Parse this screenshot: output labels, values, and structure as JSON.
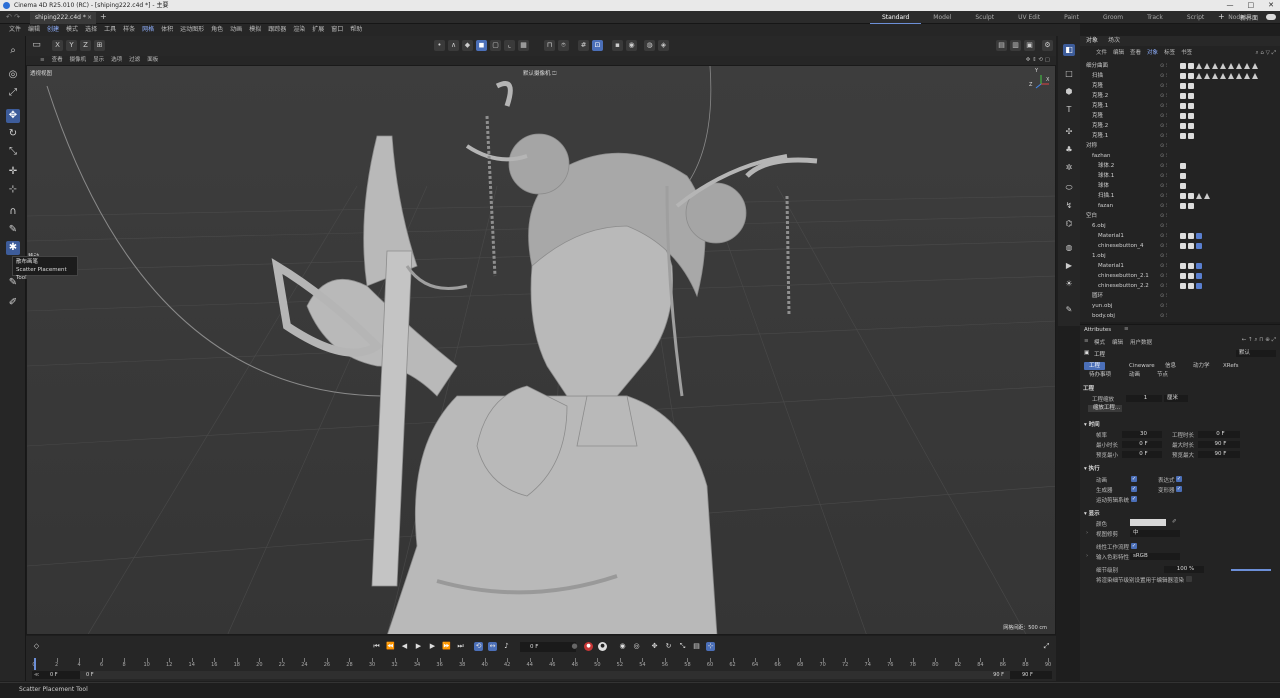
{
  "window": {
    "title": "Cinema 4D R25.010 (RC) - [shiping222.c4d *] - 主要",
    "controls": [
      "—",
      "□",
      "✕"
    ]
  },
  "tabs": {
    "document": "shiping222.c4d *",
    "add": "+"
  },
  "layouts": [
    "Standard",
    "Model",
    "Sculpt",
    "UV Edit",
    "Paint",
    "Groom",
    "Track",
    "Script",
    "Nodes"
  ],
  "layout_active": "Standard",
  "layout_extra": "新界面",
  "menu": [
    "文件",
    "编辑",
    "创建",
    "模式",
    "选择",
    "工具",
    "样条",
    "网格",
    "体积",
    "运动图形",
    "角色",
    "动画",
    "模拟",
    "跟踪器",
    "渲染",
    "扩展",
    "窗口",
    "帮助"
  ],
  "viewport": {
    "menu": [
      "查看",
      "摄像机",
      "显示",
      "选项",
      "过滤",
      "面板"
    ],
    "name": "透视视图",
    "camera": "默认摄像机 ⏍",
    "grid_spacing": "网格间距：500 cm",
    "axis": {
      "x": "X",
      "y": "Y",
      "z": "Z"
    }
  },
  "toolbar_axes": [
    "X",
    "Y",
    "Z"
  ],
  "tooltip": {
    "title": "散布画笔",
    "subtitle": "Scatter Placement Tool",
    "move": "移动"
  },
  "timeline": {
    "current_frame": "0 F",
    "ticks": [
      "0",
      "2",
      "4",
      "6",
      "8",
      "10",
      "12",
      "14",
      "16",
      "18",
      "20",
      "22",
      "24",
      "26",
      "28",
      "30",
      "32",
      "34",
      "36",
      "38",
      "40",
      "42",
      "44",
      "46",
      "48",
      "50",
      "52",
      "54",
      "56",
      "58",
      "60",
      "62",
      "64",
      "66",
      "68",
      "70",
      "72",
      "74",
      "76",
      "78",
      "80",
      "82",
      "84",
      "86",
      "88",
      "90"
    ],
    "range_start": "0 F",
    "range_start2": "0 F",
    "range_end": "90 F",
    "range_end2": "90 F"
  },
  "status": "Scatter Placement Tool",
  "objects": {
    "tabs": [
      "对象",
      "场次"
    ],
    "menu": [
      "文件",
      "编辑",
      "查看",
      "对象",
      "标签",
      "书签"
    ],
    "menu_active": "对象",
    "rows": [
      {
        "name": "细分曲面",
        "indent": 0,
        "tags": "t"
      },
      {
        "name": "扫描",
        "indent": 1,
        "tags": "sweep"
      },
      {
        "name": "克隆",
        "indent": 1,
        "tags": "pair"
      },
      {
        "name": "克隆.2",
        "indent": 1,
        "tags": "pair"
      },
      {
        "name": "克隆.1",
        "indent": 1,
        "tags": "pair"
      },
      {
        "name": "克隆",
        "indent": 1,
        "tags": "pair"
      },
      {
        "name": "克隆.2",
        "indent": 1,
        "tags": "pair"
      },
      {
        "name": "克隆.1",
        "indent": 1,
        "tags": "pair"
      },
      {
        "name": "对称",
        "indent": 0,
        "tags": "none"
      },
      {
        "name": "fazhan",
        "indent": 1,
        "tags": "none"
      },
      {
        "name": "球体.2",
        "indent": 2,
        "tags": "one"
      },
      {
        "name": "球体.1",
        "indent": 2,
        "tags": "one"
      },
      {
        "name": "球体",
        "indent": 2,
        "tags": "one"
      },
      {
        "name": "扫描.1",
        "indent": 2,
        "tags": "tri2"
      },
      {
        "name": "fazan",
        "indent": 2,
        "tags": "two"
      },
      {
        "name": "空白",
        "indent": 0,
        "tags": "none"
      },
      {
        "name": "6.obj",
        "indent": 1,
        "tags": "none"
      },
      {
        "name": "Material1",
        "indent": 2,
        "tags": "three"
      },
      {
        "name": "chinesebutton_4",
        "indent": 2,
        "tags": "three"
      },
      {
        "name": "1.obj",
        "indent": 1,
        "tags": "none"
      },
      {
        "name": "Material1",
        "indent": 2,
        "tags": "three"
      },
      {
        "name": "chinesebutton_2.1",
        "indent": 2,
        "tags": "three"
      },
      {
        "name": "chinesebutton_2.2",
        "indent": 2,
        "tags": "three"
      },
      {
        "name": "圆环",
        "indent": 1,
        "tags": "none"
      },
      {
        "name": "yun.obj",
        "indent": 1,
        "tags": "none"
      },
      {
        "name": "body.obj",
        "indent": 1,
        "tags": "none"
      }
    ]
  },
  "attributes": {
    "title": "Attributes",
    "menu": [
      "模式",
      "编辑",
      "用户数据"
    ],
    "object": "工程",
    "preset": "默认",
    "tabs": [
      "工程",
      "Cineware",
      "信息",
      "动力学",
      "XRefs"
    ],
    "tabs2": [
      "待办事项",
      "动画",
      "节点"
    ],
    "section_project": "工程",
    "scale_label": "工程缩放",
    "scale_value": "1",
    "scale_unit": "厘米",
    "scale_button": "缩放工程...",
    "section_time": "▾ 时间",
    "fps_label": "帧率",
    "fps_value": "30",
    "project_len_label": "工程时长",
    "project_len_value": "0 F",
    "min_len_label": "最小时长",
    "min_len_value": "0 F",
    "max_len_label": "最大时长",
    "max_len_value": "90 F",
    "preview_min_label": "预览最小",
    "preview_min_value": "0 F",
    "preview_max_label": "预览最大",
    "preview_max_value": "90 F",
    "section_exec": "▾ 执行",
    "anim_label": "动画",
    "expr_label": "表达式",
    "gen_label": "生成器",
    "deform_label": "变形器",
    "motion_label": "运动剪辑系统",
    "section_display": "▾ 显示",
    "color_label": "颜色",
    "lod_label": "视图修剪",
    "lod_value": "中",
    "linear_label": "线性工作流程",
    "input_color_label": "输入色彩特性",
    "input_color_value": "sRGB",
    "detail_label": "细节级别",
    "detail_value": "100 %",
    "render_lod_label": "将渲染细节级别设置用于编辑器渲染"
  }
}
